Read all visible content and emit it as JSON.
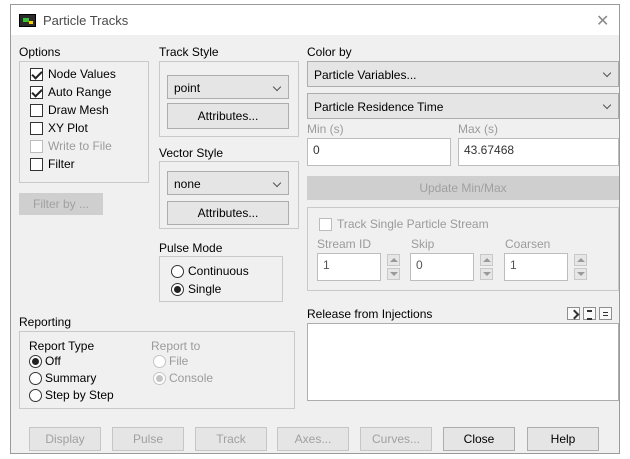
{
  "window": {
    "title": "Particle Tracks"
  },
  "options": {
    "heading": "Options",
    "node_values": "Node Values",
    "auto_range": "Auto Range",
    "draw_mesh": "Draw Mesh",
    "xy_plot": "XY Plot",
    "write_to_file": "Write to File",
    "filter": "Filter",
    "filter_by": "Filter by ..."
  },
  "track_style": {
    "heading": "Track Style",
    "value": "point",
    "attributes": "Attributes..."
  },
  "vector_style": {
    "heading": "Vector Style",
    "value": "none",
    "attributes": "Attributes..."
  },
  "pulse_mode": {
    "heading": "Pulse Mode",
    "continuous": "Continuous",
    "single": "Single"
  },
  "color_by": {
    "heading": "Color by",
    "primary": "Particle Variables...",
    "secondary": "Particle Residence Time",
    "min_label": "Min (s)",
    "max_label": "Max (s)",
    "min_value": "0",
    "max_value": "43.67468",
    "update": "Update Min/Max"
  },
  "stream": {
    "track_single": "Track Single Particle Stream",
    "stream_id_label": "Stream ID",
    "skip_label": "Skip",
    "coarsen_label": "Coarsen",
    "stream_id": "1",
    "skip": "0",
    "coarsen": "1"
  },
  "reporting": {
    "heading": "Reporting",
    "report_type": "Report Type",
    "off": "Off",
    "summary": "Summary",
    "step_by_step": "Step by Step",
    "report_to": "Report to",
    "file": "File",
    "console": "Console"
  },
  "release": {
    "heading": "Release from Injections"
  },
  "buttons": {
    "display": "Display",
    "pulse": "Pulse",
    "track": "Track",
    "axes": "Axes...",
    "curves": "Curves...",
    "close": "Close",
    "help": "Help"
  }
}
